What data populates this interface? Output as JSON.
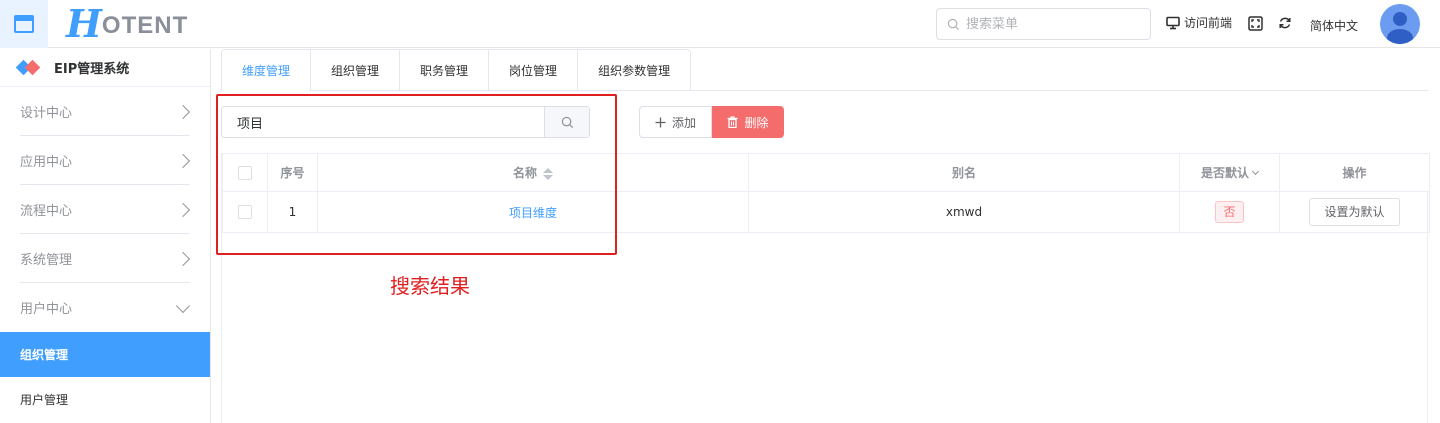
{
  "header": {
    "logo_h": "H",
    "logo_rest": "OTENT",
    "search_placeholder": "搜索菜单",
    "visit_frontend": "访问前端",
    "language": "简体中文"
  },
  "sidebar": {
    "brand": "EIP管理系统",
    "items": [
      {
        "label": "设计中心"
      },
      {
        "label": "应用中心"
      },
      {
        "label": "流程中心"
      },
      {
        "label": "系统管理"
      },
      {
        "label": "用户中心"
      }
    ],
    "sub_active": "组织管理",
    "sub_item": "用户管理"
  },
  "tabs": [
    {
      "label": "维度管理",
      "active": true
    },
    {
      "label": "组织管理"
    },
    {
      "label": "职务管理"
    },
    {
      "label": "岗位管理"
    },
    {
      "label": "组织参数管理"
    }
  ],
  "toolbar": {
    "query_value": "项目",
    "add_label": "添加",
    "delete_label": "删除"
  },
  "table": {
    "headers": {
      "index": "序号",
      "name": "名称",
      "alias": "别名",
      "is_default": "是否默认",
      "actions": "操作"
    },
    "rows": [
      {
        "index": "1",
        "name": "项目维度",
        "alias": "xmwd",
        "is_default": "否",
        "action": "设置为默认"
      }
    ]
  },
  "annotation": "搜索结果",
  "colors": {
    "primary": "#409eff",
    "danger": "#f56c6c",
    "highlight": "#e02020"
  }
}
